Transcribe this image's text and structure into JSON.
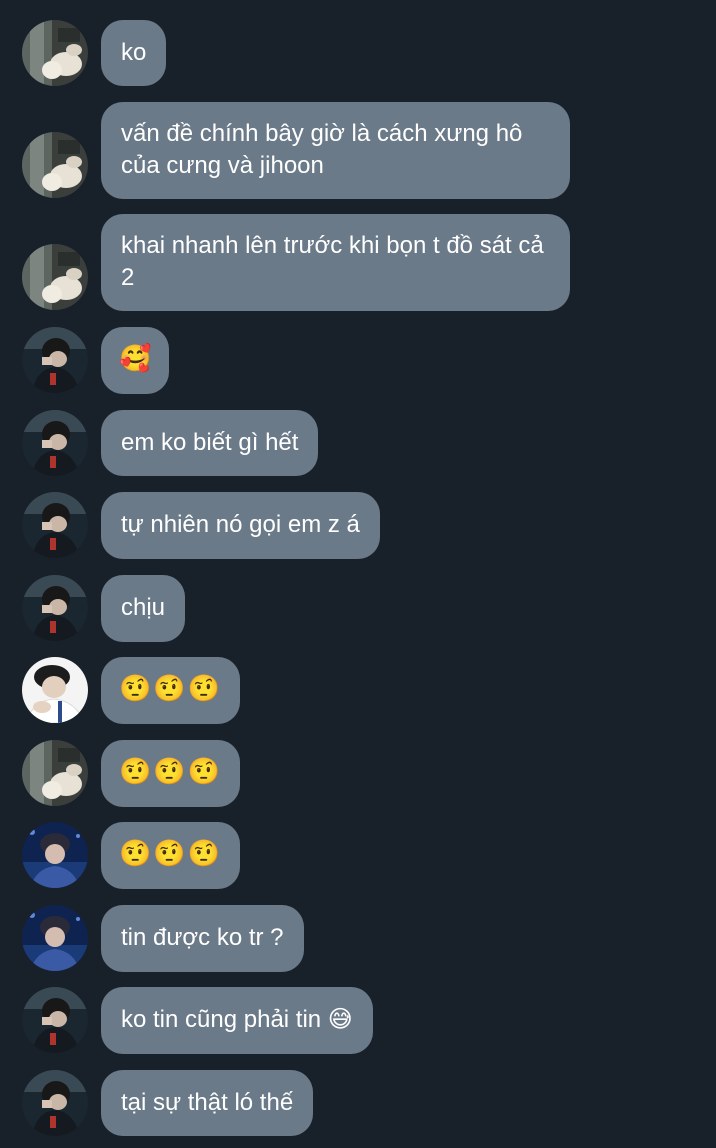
{
  "theme": {
    "background": "#18202a",
    "bubble_color": "#6b7a89",
    "text_color": "#ffffff"
  },
  "messages": [
    {
      "avatar": "avatar-hands",
      "text": "ko"
    },
    {
      "avatar": "avatar-hands",
      "text": "vấn đề chính bây giờ là cách xưng hô của cưng và jihoon"
    },
    {
      "avatar": "avatar-hands",
      "text": "khai nhanh lên trước khi bọn t đồ sát cả 2"
    },
    {
      "avatar": "avatar-dark-portrait",
      "text": "🥰"
    },
    {
      "avatar": "avatar-dark-portrait",
      "text": "em ko biết gì hết"
    },
    {
      "avatar": "avatar-dark-portrait",
      "text": "tự nhiên nó gọi em z á"
    },
    {
      "avatar": "avatar-dark-portrait",
      "text": "chịu"
    },
    {
      "avatar": "avatar-white-shirt",
      "text": "🤨🤨🤨"
    },
    {
      "avatar": "avatar-hands",
      "text": "🤨🤨🤨"
    },
    {
      "avatar": "avatar-blue-stage",
      "text": "🤨🤨🤨"
    },
    {
      "avatar": "avatar-blue-stage",
      "text": "tin được ko tr ?"
    },
    {
      "avatar": "avatar-dark-portrait",
      "text": "ko tin cũng phải tin 😅"
    },
    {
      "avatar": "avatar-dark-portrait",
      "text": "tại sự thật ló thế"
    }
  ]
}
